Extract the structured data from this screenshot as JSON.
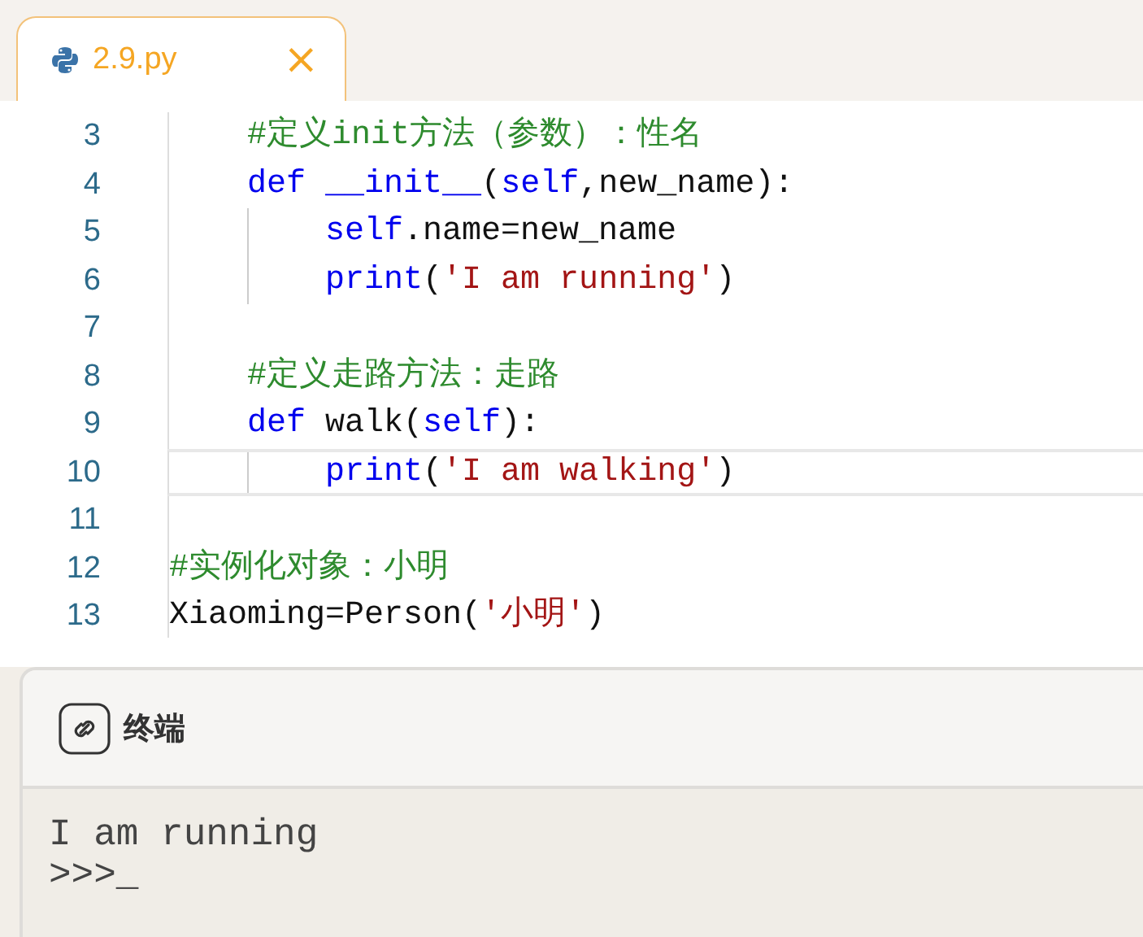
{
  "tabs": [
    {
      "title": "2.9.py",
      "close": "×",
      "selected": true
    }
  ],
  "editor": {
    "lines": [
      {
        "number": "3",
        "current": false,
        "tokens": [
          {
            "kind": "comment",
            "text": "    #定义init方法（参数）：性名"
          }
        ]
      },
      {
        "number": "4",
        "current": false,
        "tokens": [
          {
            "kind": "keyword",
            "text": "    def"
          },
          {
            "kind": "keyword",
            "text": " __init__"
          },
          {
            "kind": "plain",
            "text": "("
          },
          {
            "kind": "keyword",
            "text": "self"
          },
          {
            "kind": "plain",
            "text": ",new_name):"
          }
        ]
      },
      {
        "number": "5",
        "current": false,
        "tokens": [
          {
            "kind": "keyword",
            "text": "        self"
          },
          {
            "kind": "plain",
            "text": ".name=new_name"
          }
        ]
      },
      {
        "number": "6",
        "current": false,
        "tokens": [
          {
            "kind": "keyword",
            "text": "        print"
          },
          {
            "kind": "plain",
            "text": "("
          },
          {
            "kind": "string",
            "text": "'I am running'"
          },
          {
            "kind": "plain",
            "text": ")"
          }
        ]
      },
      {
        "number": "7",
        "current": false
      },
      {
        "number": "8",
        "current": false,
        "tokens": [
          {
            "kind": "comment",
            "text": "    #定义走路方法：走路"
          }
        ]
      },
      {
        "number": "9",
        "current": false,
        "tokens": [
          {
            "kind": "keyword",
            "text": "    def"
          },
          {
            "kind": "plain",
            "text": " walk("
          },
          {
            "kind": "keyword",
            "text": "self"
          },
          {
            "kind": "plain",
            "text": "):"
          }
        ]
      },
      {
        "number": "10",
        "current": true,
        "tokens": [
          {
            "kind": "keyword",
            "text": "        print"
          },
          {
            "kind": "plain",
            "text": "("
          },
          {
            "kind": "string",
            "text": "'I am walking'"
          },
          {
            "kind": "plain",
            "text": ")"
          }
        ]
      },
      {
        "number": "11",
        "current": false
      },
      {
        "number": "12",
        "current": false,
        "tokens": [
          {
            "kind": "comment",
            "text": "#实例化对象：小明"
          }
        ]
      },
      {
        "number": "13",
        "current": false,
        "tokens": [
          {
            "kind": "plain",
            "text": "Xiaoming=Person("
          },
          {
            "kind": "string",
            "text": "'小明'"
          },
          {
            "kind": "plain",
            "text": ")"
          }
        ]
      }
    ]
  },
  "terminal": {
    "title": "终端",
    "output": [
      "I am running",
      ">>>_"
    ]
  }
}
